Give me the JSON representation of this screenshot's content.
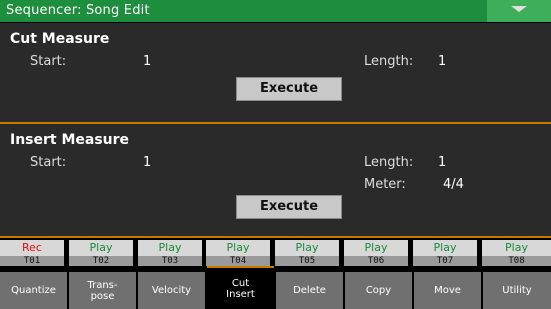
{
  "header": {
    "title": "Sequencer: Song Edit",
    "menu_icon": "chevron-down-icon"
  },
  "cut_measure": {
    "title": "Cut Measure",
    "start_label": "Start:",
    "start_value": "1",
    "length_label": "Length:",
    "length_value": "1",
    "execute_label": "Execute"
  },
  "insert_measure": {
    "title": "Insert Measure",
    "start_label": "Start:",
    "start_value": "1",
    "length_label": "Length:",
    "length_value": "1",
    "meter_label": "Meter:",
    "meter_value": "4/4",
    "execute_label": "Execute"
  },
  "tracks": [
    {
      "state": "Rec",
      "name": "T01"
    },
    {
      "state": "Play",
      "name": "T02"
    },
    {
      "state": "Play",
      "name": "T03"
    },
    {
      "state": "Play",
      "name": "T04"
    },
    {
      "state": "Play",
      "name": "T05"
    },
    {
      "state": "Play",
      "name": "T06"
    },
    {
      "state": "Play",
      "name": "T07"
    },
    {
      "state": "Play",
      "name": "T08"
    }
  ],
  "tabs": [
    {
      "line1": "Quantize",
      "line2": ""
    },
    {
      "line1": "Trans-",
      "line2": "pose"
    },
    {
      "line1": "Velocity",
      "line2": ""
    },
    {
      "line1": "Cut",
      "line2": "Insert"
    },
    {
      "line1": "Delete",
      "line2": ""
    },
    {
      "line1": "Copy",
      "line2": ""
    },
    {
      "line1": "Move",
      "line2": ""
    },
    {
      "line1": "Utility",
      "line2": ""
    }
  ],
  "colors": {
    "header_green": "#1d8d3e",
    "separator_orange": "#c97800",
    "rec_red": "#dd1111",
    "play_green": "#1a8a3a"
  }
}
